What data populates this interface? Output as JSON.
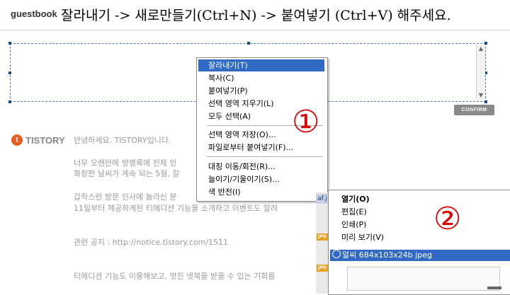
{
  "header": {
    "brand": "guestbook",
    "instruction": "잘라내기 -> 새로만들기(Ctrl+N) -> 붙여넣기 (Ctrl+V) 해주세요."
  },
  "editor": {
    "confirm_label": "CONFIRM"
  },
  "blog": {
    "logo_letter": "t",
    "name": "TISTORY",
    "lines": [
      "안녕하세요. TISTORY입니다.",
      "너무 오랜만에 방명록에 전체 인",
      "화창한 날씨가 계속 되는 5월, 잘",
      "갑작스런 방문 인사에 놀라신 분",
      "11일부터 제공하게된 티에디션 기능을 소개하고 이벤트도 알려",
      "관련 공지 : http://notice.tistory.com/1511",
      "티에디션 기능도 이용해보고, 멋진 넷북을 받을 수 있는 기회를"
    ]
  },
  "context_menu": {
    "items": [
      "잘라내기(T)",
      "복사(C)",
      "붙여넣기(P)",
      "선택 영역 지우기(L)",
      "모두 선택(A)",
      "선택 영역 저장(O)...",
      "파일로부터 붙여넣기(F)...",
      "대칭 이동/회전(R)...",
      "늘이기/기울이기(S)...",
      "색 반전(I)"
    ],
    "annotation": "①"
  },
  "second_menu": {
    "items": [
      "열기(O)",
      "편집(E)",
      "인쇄(P)",
      "미리 보기(V)"
    ],
    "annotation": "②",
    "file_label": "알씨 684x103x24b jpeg"
  },
  "left_strip": {
    "label": "af.j",
    "jpg": "JPG"
  },
  "colors": {
    "highlight": "#316ac5",
    "annotation": "#e00000",
    "tistory_orange": "#e85d22"
  }
}
